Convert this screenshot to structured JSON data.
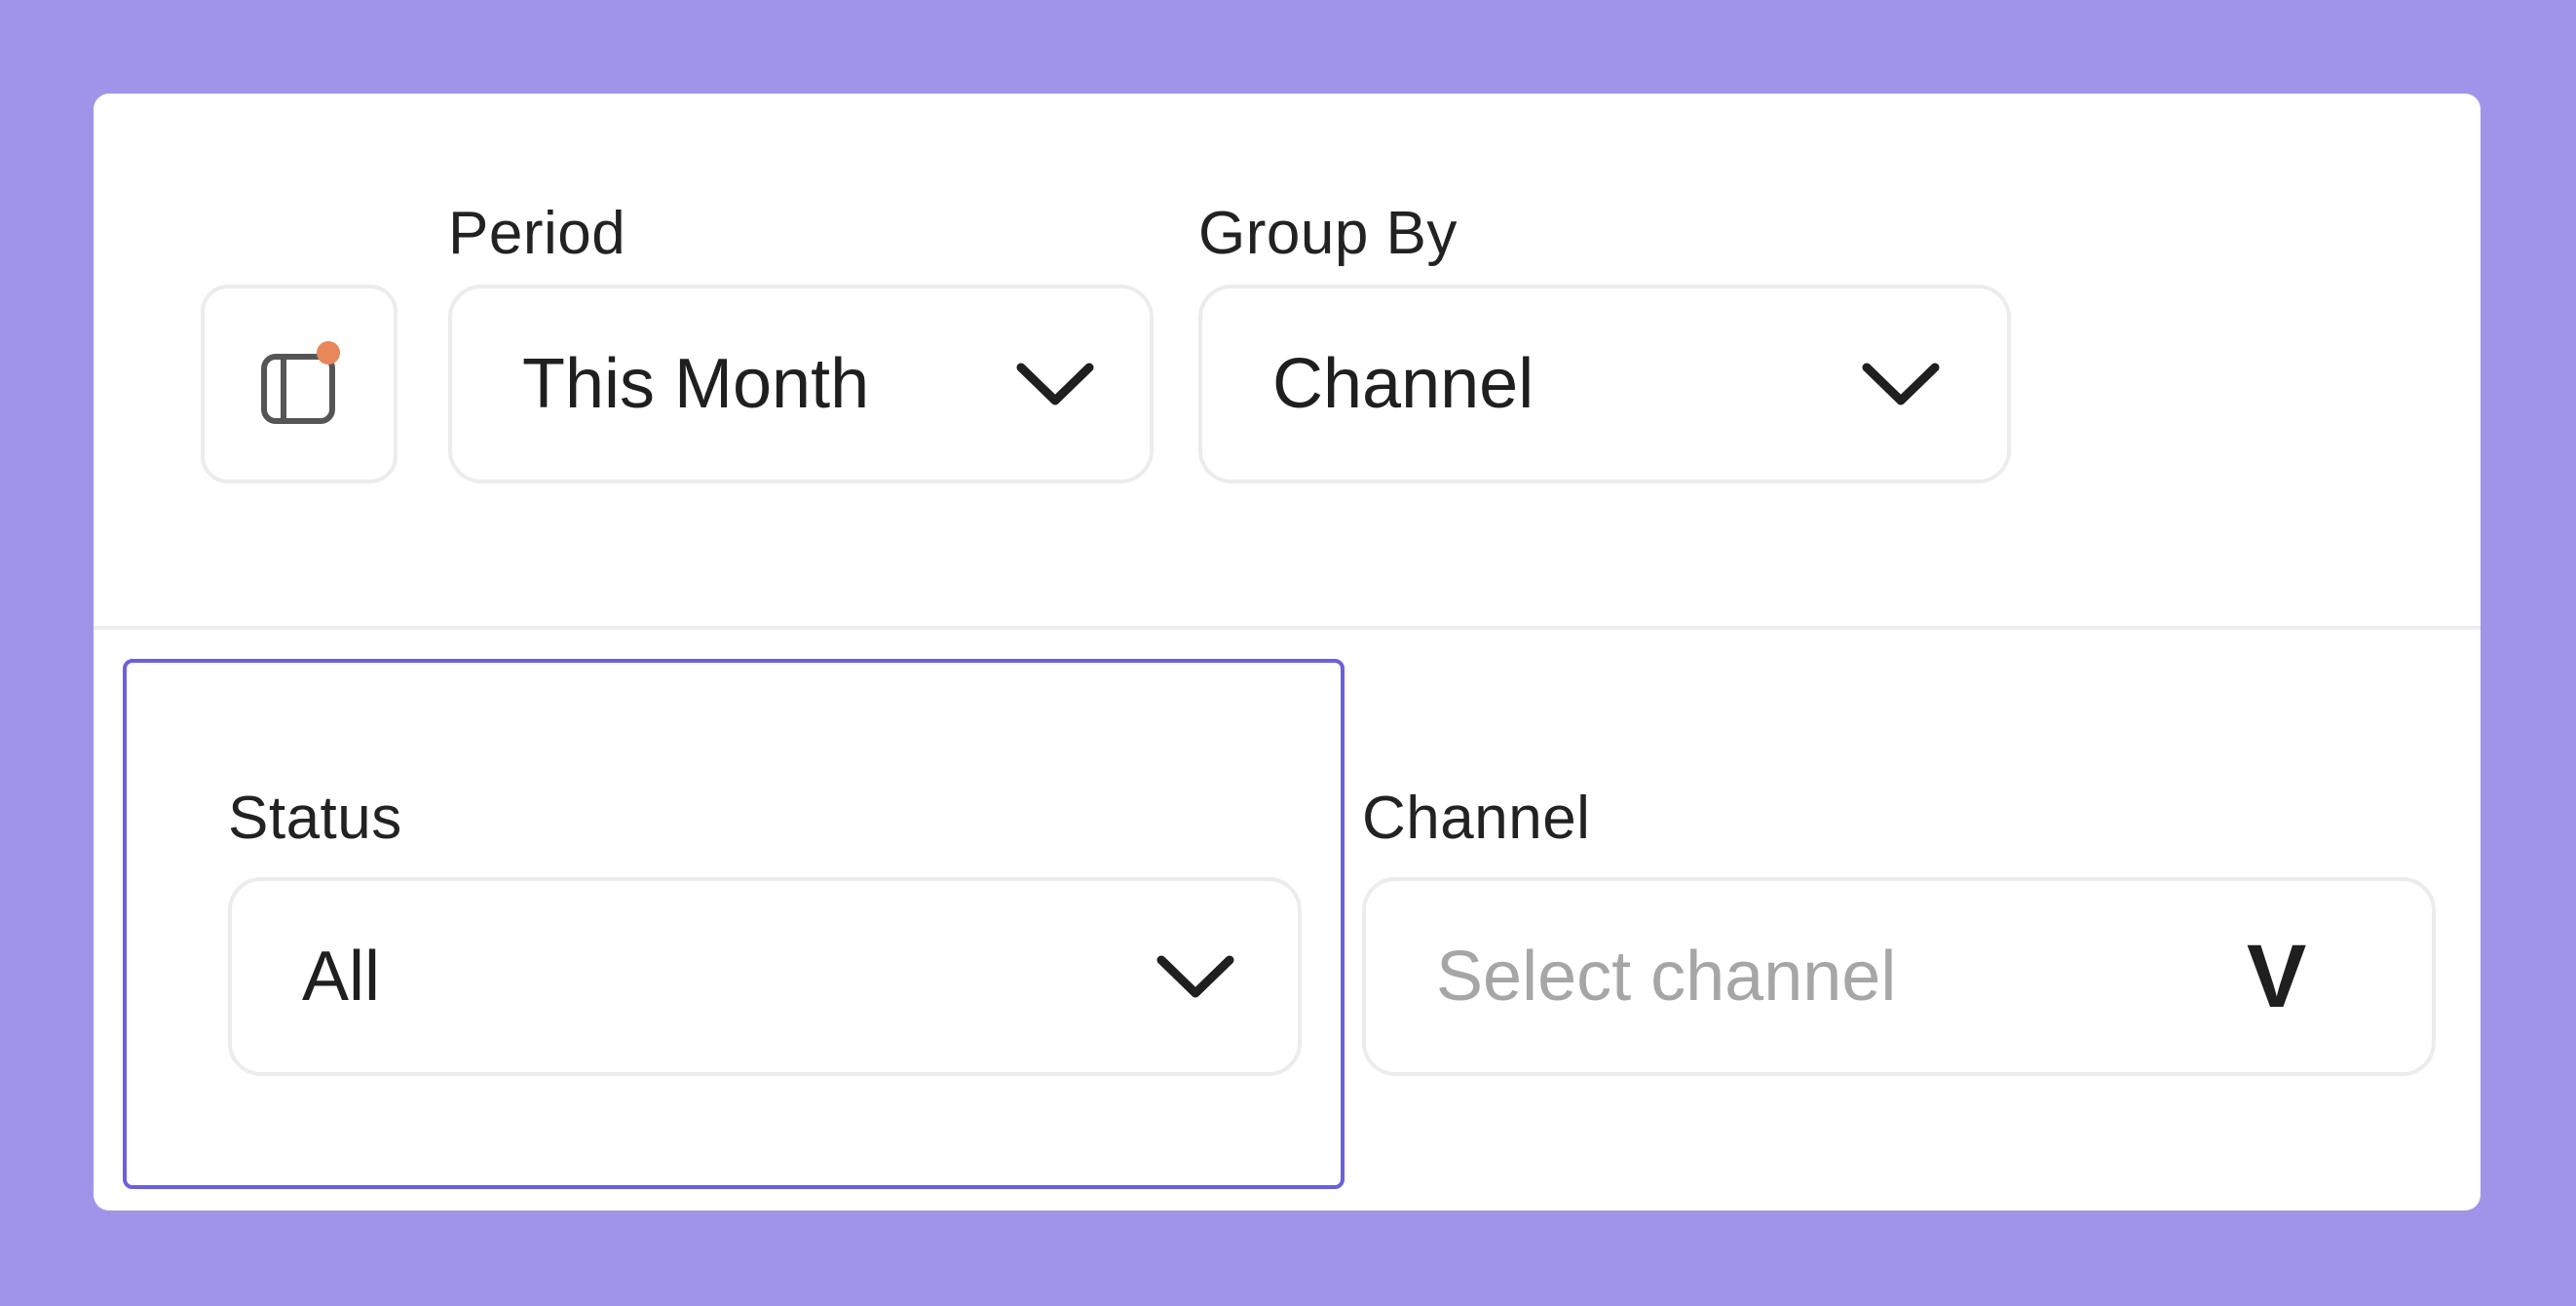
{
  "filters": {
    "period": {
      "label": "Period",
      "value": "This Month"
    },
    "group_by": {
      "label": "Group By",
      "value": "Channel"
    },
    "status": {
      "label": "Status",
      "value": "All"
    },
    "channel": {
      "label": "Channel",
      "placeholder": "Select channel",
      "chevron_glyph": "V"
    }
  },
  "icons": {
    "panel_toggle": "sidebar-panel-icon",
    "chevron": "chevron-down-icon"
  },
  "colors": {
    "background": "#9f94ea",
    "panel": "#ffffff",
    "focus_border": "#6b5fe0",
    "notification_dot": "#e8875a",
    "placeholder_text": "#a6a6a6"
  }
}
